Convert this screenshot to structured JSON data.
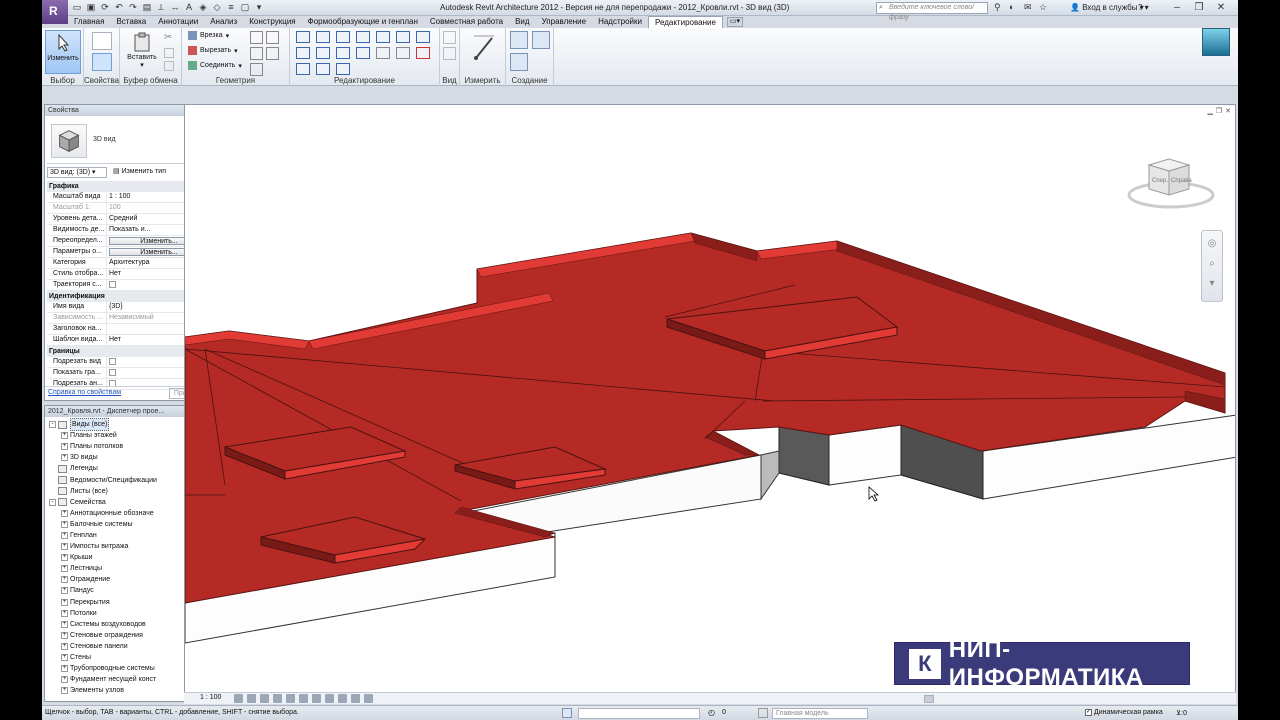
{
  "title": "Autodesk Revit Architecture 2012 - Версия не для перепродажи -     2012_Кровли.rvt - 3D вид (3D)",
  "search_placeholder": "Введите ключевое слово/фразу",
  "login": "Вход в службы",
  "tabs": [
    "Главная",
    "Вставка",
    "Аннотации",
    "Анализ",
    "Конструкция",
    "Формообразующие и генплан",
    "Совместная работа",
    "Вид",
    "Управление",
    "Надстройки",
    "Редактирование"
  ],
  "active_tab": "Редактирование",
  "ribbon": {
    "modify_label": "Изменить",
    "paste_label": "Вставить",
    "cut_label": "Врезка",
    "cutout_label": "Вырезать",
    "join_label": "Соединить",
    "panels": [
      "Выбор",
      "Свойства",
      "Буфер обмена",
      "Геометрия",
      "Редактирование",
      "Вид",
      "Измерить",
      "Создание"
    ]
  },
  "properties": {
    "title": "Свойства",
    "type_name": "3D вид",
    "view_selector": "3D вид: (3D)",
    "edit_type": "Изменить тип",
    "sections": [
      {
        "name": "Графика",
        "rows": [
          {
            "k": "Масштаб вида",
            "v": "1 : 100"
          },
          {
            "k": "Масштаб   1:",
            "v": "100",
            "grey": true
          },
          {
            "k": "Уровень дета...",
            "v": "Средний"
          },
          {
            "k": "Видимость де...",
            "v": "Показать и..."
          },
          {
            "k": "Переопредел...",
            "v": "Изменить...",
            "button": true
          },
          {
            "k": "Параметры о...",
            "v": "Изменить...",
            "button": true
          },
          {
            "k": "Категория",
            "v": "Архитектура"
          },
          {
            "k": "Стиль отобра...",
            "v": "Нет"
          },
          {
            "k": "Траектория с...",
            "v": "",
            "check": true
          }
        ]
      },
      {
        "name": "Идентификация",
        "rows": [
          {
            "k": "Имя вида",
            "v": "{3D}"
          },
          {
            "k": "Зависимость ...",
            "v": "Независимый",
            "grey": true
          },
          {
            "k": "Заголовок на...",
            "v": ""
          },
          {
            "k": "Шаблон вида...",
            "v": "Нет"
          }
        ]
      },
      {
        "name": "Границы",
        "rows": [
          {
            "k": "Подрезать вид",
            "v": "",
            "check": true
          },
          {
            "k": "Показать гра...",
            "v": "",
            "check": true
          },
          {
            "k": "Подрезать ан...",
            "v": "",
            "check": true
          }
        ]
      }
    ],
    "help_link": "Справка по свойствам",
    "apply": "Применить"
  },
  "browser": {
    "title": "2012_Кровля.rvt - Диспетчер прое...",
    "nodes": [
      {
        "label": "Виды (все)",
        "level": 0,
        "pm": "-",
        "sel": true
      },
      {
        "label": "Планы этажей",
        "level": 1,
        "pm": "+"
      },
      {
        "label": "Планы потолков",
        "level": 1,
        "pm": "+"
      },
      {
        "label": "3D виды",
        "level": 1,
        "pm": "+"
      },
      {
        "label": "Легенды",
        "level": 0,
        "pm": "",
        "icon": true
      },
      {
        "label": "Ведомости/Спецификации",
        "level": 0,
        "pm": "",
        "icon": true
      },
      {
        "label": "Листы (все)",
        "level": 0,
        "pm": "",
        "icon": true
      },
      {
        "label": "Семейства",
        "level": 0,
        "pm": "-",
        "icon": true
      },
      {
        "label": "Аннотационные обозначе",
        "level": 1,
        "pm": "+"
      },
      {
        "label": "Балочные системы",
        "level": 1,
        "pm": "+"
      },
      {
        "label": "Генплан",
        "level": 1,
        "pm": "+"
      },
      {
        "label": "Импосты витража",
        "level": 1,
        "pm": "+"
      },
      {
        "label": "Крыши",
        "level": 1,
        "pm": "+"
      },
      {
        "label": "Лестницы",
        "level": 1,
        "pm": "+"
      },
      {
        "label": "Ограждение",
        "level": 1,
        "pm": "+"
      },
      {
        "label": "Пандус",
        "level": 1,
        "pm": "+"
      },
      {
        "label": "Перекрытия",
        "level": 1,
        "pm": "+"
      },
      {
        "label": "Потолки",
        "level": 1,
        "pm": "+"
      },
      {
        "label": "Системы воздуховодов",
        "level": 1,
        "pm": "+"
      },
      {
        "label": "Стеновые ограждения",
        "level": 1,
        "pm": "+"
      },
      {
        "label": "Стеновые панели",
        "level": 1,
        "pm": "+"
      },
      {
        "label": "Стены",
        "level": 1,
        "pm": "+"
      },
      {
        "label": "Трубопроводные системы",
        "level": 1,
        "pm": "+"
      },
      {
        "label": "Фундамент несущей конст",
        "level": 1,
        "pm": "+"
      },
      {
        "label": "Элементы узлов",
        "level": 1,
        "pm": "+"
      }
    ]
  },
  "viewport": {
    "scale": "1 : 100",
    "viewcube_left": "Спер.",
    "viewcube_right": "Справа",
    "watermark": "НИП-ИНФОРМАТИКА",
    "watermark_mark": "К"
  },
  "status": {
    "message": "Щелчок - выбор, TAB - варианты, CTRL - добавление, SHIFT - снятие выбора.",
    "zero": "0",
    "model": "Главная модель",
    "dynamic_frame": "Динамическая рамка",
    "filter": "⊻:0"
  },
  "colors": {
    "roof_top": "#b52a25",
    "roof_edge": "#e03a35",
    "roof_side": "#7a1a17",
    "wall_dark": "#5a5a5a",
    "brand": "#3b3a7a"
  }
}
